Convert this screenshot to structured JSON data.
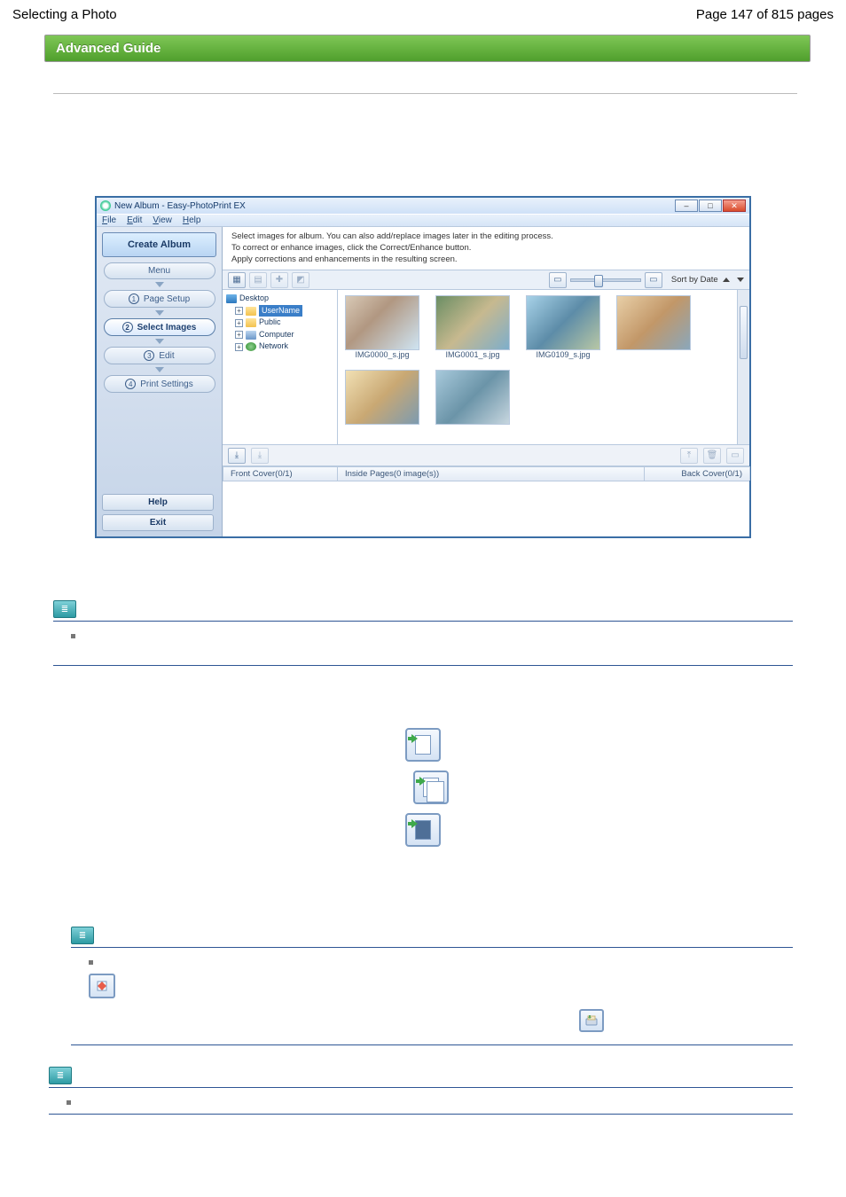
{
  "header": {
    "left": "Selecting a Photo",
    "right": "Page 147 of 815 pages"
  },
  "banner": "Advanced Guide",
  "win": {
    "title": "New Album - Easy-PhotoPrint EX",
    "win_buttons": {
      "min": "–",
      "max": "□",
      "close": "✕"
    },
    "menus": {
      "file": "File",
      "edit": "Edit",
      "view": "View",
      "help": "Help"
    },
    "sidebar": {
      "create": "Create Album",
      "menu": "Menu",
      "steps": {
        "page_setup_num": "①",
        "page_setup": "Page Setup",
        "select_images_num": "②",
        "select_images": "Select Images",
        "edit_num": "③",
        "edit": "Edit",
        "print_settings_num": "④",
        "print_settings": "Print Settings"
      },
      "help": "Help",
      "exit": "Exit"
    },
    "instruction": {
      "l1": "Select images for album. You can also add/replace images later in the editing process.",
      "l2": "To correct or enhance images, click the Correct/Enhance button.",
      "l3": "Apply corrections and enhancements in the resulting screen."
    },
    "toolbar": {
      "sort_label": "Sort by Date"
    },
    "tree": {
      "desktop": "Desktop",
      "username": "UserName",
      "public": "Public",
      "computer": "Computer",
      "network": "Network"
    },
    "thumbs": {
      "f1": "IMG0000_s.jpg",
      "f2": "IMG0001_s.jpg",
      "f3": "IMG0109_s.jpg"
    },
    "tabs": {
      "front": "Front Cover(0/1)",
      "inside": "Inside Pages(0 image(s))",
      "back": "Back Cover(0/1)"
    }
  }
}
